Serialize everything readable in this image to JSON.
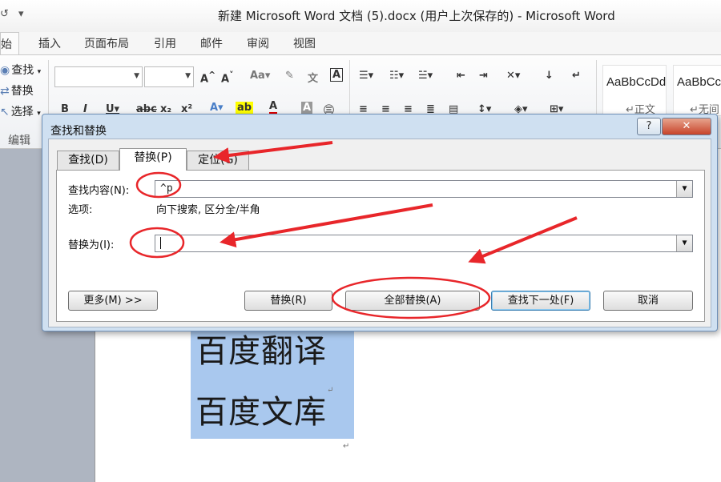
{
  "window": {
    "title": "新建 Microsoft Word 文档 (5).docx (用户上次保存的)  -  Microsoft Word",
    "qat": [
      "↺",
      "▾"
    ]
  },
  "ribbon_tabs": [
    {
      "label": "始",
      "active": true
    },
    {
      "label": "插入"
    },
    {
      "label": "页面布局"
    },
    {
      "label": "引用"
    },
    {
      "label": "邮件"
    },
    {
      "label": "审阅"
    },
    {
      "label": "视图"
    }
  ],
  "ribbon": {
    "edit_find": "查找",
    "edit_replace": "替换",
    "edit_select": "选择",
    "edit_group": "编辑",
    "style_normal_preview": "AaBbCcDd",
    "style_normal_name": "正文",
    "style_nospace_preview": "AaBbCc",
    "style_nospace_name": "无间隔"
  },
  "document": {
    "lines": [
      "百度翻译",
      "百度文库"
    ],
    "para_mark": "↵"
  },
  "dialog": {
    "title": "查找和替换",
    "help": "?",
    "close": "✕",
    "tabs": [
      "查找(D)",
      "替换(P)",
      "定位(G)"
    ],
    "active_tab": 1,
    "find_label": "查找内容(N):",
    "find_value": "^p",
    "options_label": "选项:",
    "options_value": "向下搜索, 区分全/半角",
    "replace_label": "替换为(I):",
    "replace_value": "",
    "buttons": {
      "more": "更多(M) >>",
      "replace": "替换(R)",
      "replace_all": "全部替换(A)",
      "find_next": "查找下一处(F)",
      "cancel": "取消"
    }
  },
  "colors": {
    "annotation": "#e8262a",
    "selection": "#a9c8ee",
    "dialog_frame": "#cfe0f1"
  }
}
